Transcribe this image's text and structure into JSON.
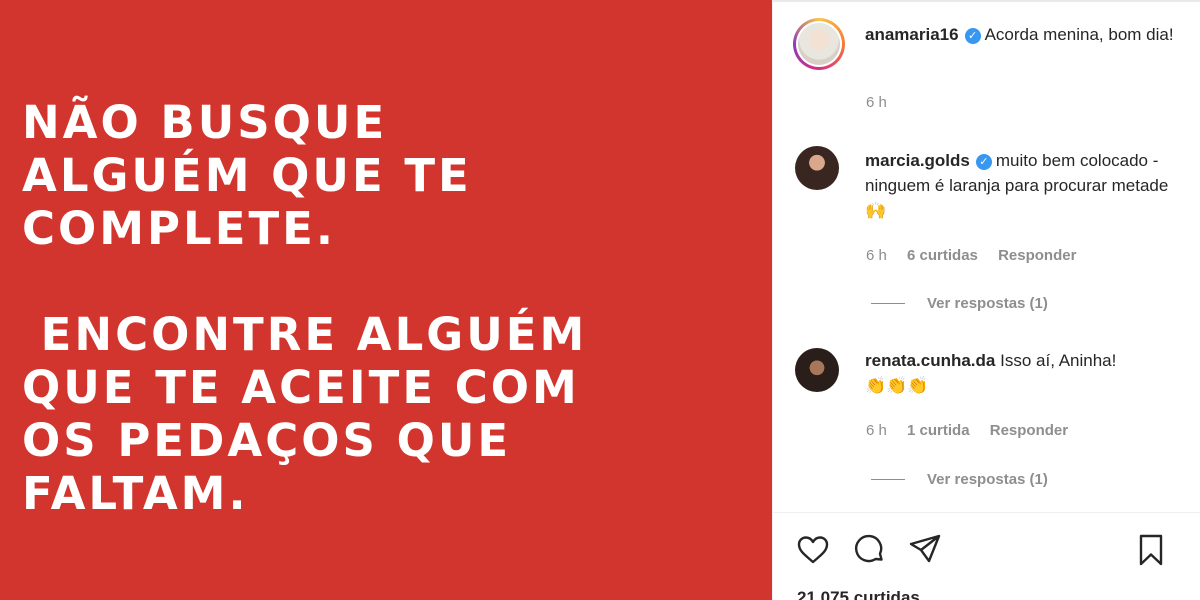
{
  "post": {
    "lines_part1": [
      "NÃO BUSQUE",
      "ALGUÉM QUE TE",
      "COMPLETE."
    ],
    "lines_part2": [
      " ENCONTRE ALGUÉM",
      "QUE TE ACEITE COM",
      "OS PEDAÇOS QUE",
      "FALTAM."
    ]
  },
  "caption": {
    "username": "anamaria16",
    "text": "Acorda menina, bom dia!",
    "time": "6 h"
  },
  "comments": [
    {
      "username": "marcia.golds",
      "verified": true,
      "text": "muito bem colocado - ninguem é laranja para procurar metade",
      "emoji": "🙌",
      "time": "6 h",
      "likes": "6 curtidas",
      "reply": "Responder",
      "view_replies": "Ver respostas (1)"
    },
    {
      "username": "renata.cunha.da",
      "verified": false,
      "text": "Isso aí, Aninha!",
      "emoji": "👏👏👏",
      "time": "6 h",
      "likes": "1 curtida",
      "reply": "Responder",
      "view_replies": "Ver respostas (1)"
    }
  ],
  "actions": {
    "icons": [
      "heart-icon",
      "comment-icon",
      "share-icon",
      "bookmark-icon"
    ]
  },
  "likes_count": "21.075 curtidas",
  "colors": {
    "post_background": "#d1352d",
    "verified": "#3897f0",
    "meta_text": "#8e8e8e"
  }
}
